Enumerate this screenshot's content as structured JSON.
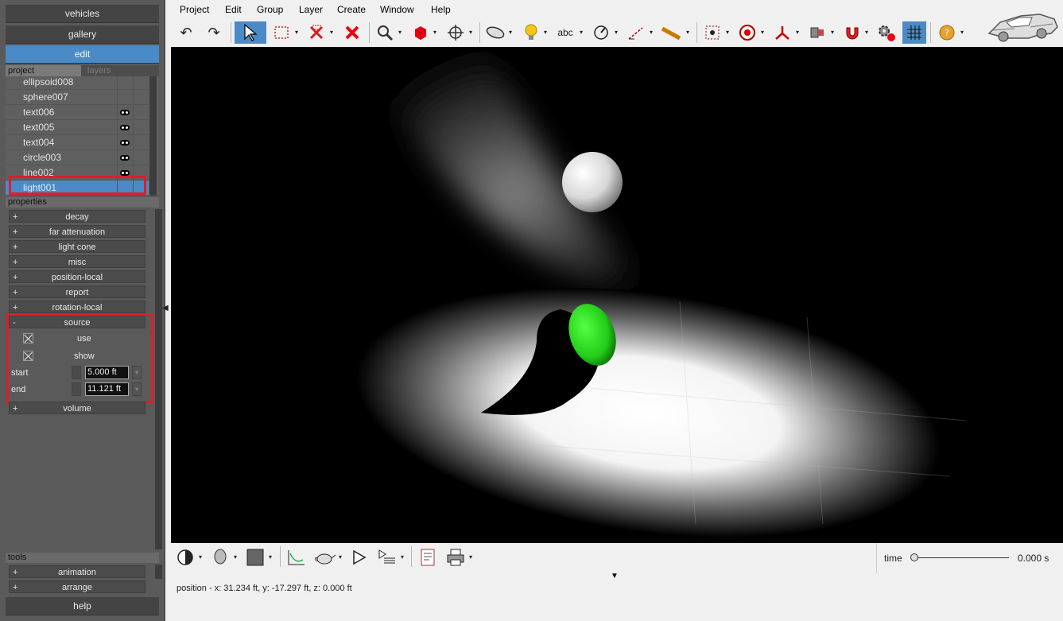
{
  "nav": {
    "vehicles": "vehicles",
    "gallery": "gallery",
    "edit": "edit",
    "help": "help"
  },
  "project": {
    "tab_project": "project",
    "tab_layers": "layers",
    "items": [
      {
        "name": "ellipsoid008",
        "visible": false
      },
      {
        "name": "sphere007",
        "visible": false
      },
      {
        "name": "text006",
        "visible": true
      },
      {
        "name": "text005",
        "visible": true
      },
      {
        "name": "text004",
        "visible": true
      },
      {
        "name": "circle003",
        "visible": true
      },
      {
        "name": "line002",
        "visible": true
      },
      {
        "name": "light001",
        "visible": false,
        "selected": true
      }
    ]
  },
  "properties": {
    "title": "properties",
    "groups": [
      {
        "sign": "+",
        "label": "decay"
      },
      {
        "sign": "+",
        "label": "far attenuation"
      },
      {
        "sign": "+",
        "label": "light cone"
      },
      {
        "sign": "+",
        "label": "misc"
      },
      {
        "sign": "+",
        "label": "position-local"
      },
      {
        "sign": "+",
        "label": "report"
      },
      {
        "sign": "+",
        "label": "rotation-local"
      }
    ],
    "source": {
      "sign": "-",
      "label": "source",
      "use_label": "use",
      "use_checked": true,
      "show_label": "show",
      "show_checked": true,
      "start_label": "start",
      "start_value": "5.000 ft",
      "end_label": "end",
      "end_value": "11.121 ft"
    },
    "volume": {
      "sign": "+",
      "label": "volume"
    }
  },
  "tools": {
    "title": "tools",
    "items": [
      {
        "sign": "+",
        "label": "animation"
      },
      {
        "sign": "+",
        "label": "arrange"
      }
    ]
  },
  "menu": [
    "Project",
    "Edit",
    "Group",
    "Layer",
    "Create",
    "Window",
    "Help"
  ],
  "toolbar": {
    "text_tool_label": "abc",
    "icons": [
      "undo-icon",
      "redo-icon",
      "select-arrow-icon",
      "rect-select-icon",
      "delete-x-icon",
      "delete-red-icon",
      "zoom-icon",
      "cube-icon",
      "move-icon",
      "ellipse-icon",
      "light-bulb-icon",
      "text-tool-icon",
      "dimension-icon",
      "measure-icon",
      "ruler-icon",
      "snap-icon",
      "target-icon",
      "axis-icon",
      "paint-icon",
      "magnet-icon",
      "settings-icon",
      "grid-icon",
      "help-icon",
      "car-logo-icon"
    ]
  },
  "status": {
    "position": "position - x: 31.234 ft, y: -17.297 ft, z: 0.000 ft",
    "time_label": "time",
    "time_value": "0.000 s",
    "time_fraction": 0.0
  },
  "colors": {
    "accent": "#4a8ac6",
    "highlight": "#e01c2c",
    "panel": "#5a5a5a",
    "viewport": "#000000",
    "sphere_green": "#33dd22"
  }
}
